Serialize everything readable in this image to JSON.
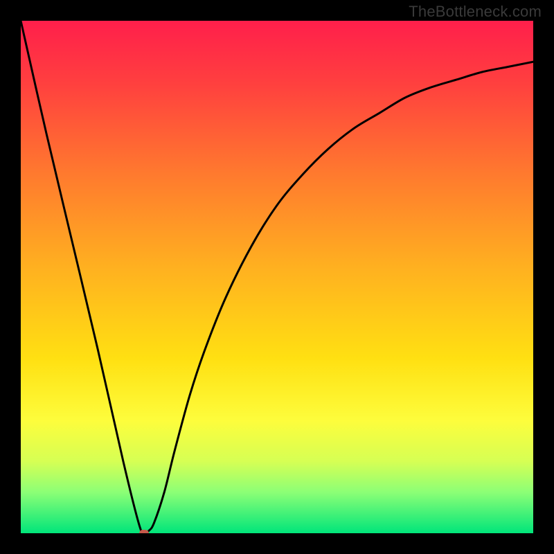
{
  "watermark": {
    "text": "TheBottleneck.com"
  },
  "colors": {
    "gradient_stops": [
      {
        "pct": 0,
        "color": "#ff1f4b"
      },
      {
        "pct": 12,
        "color": "#ff3f3f"
      },
      {
        "pct": 30,
        "color": "#ff7a2e"
      },
      {
        "pct": 48,
        "color": "#ffb020"
      },
      {
        "pct": 66,
        "color": "#ffe012"
      },
      {
        "pct": 78,
        "color": "#fdfd3c"
      },
      {
        "pct": 86,
        "color": "#d6ff54"
      },
      {
        "pct": 92,
        "color": "#8cff76"
      },
      {
        "pct": 100,
        "color": "#00e57a"
      }
    ],
    "curve_stroke": "#000000",
    "marker_fill": "#c55a4b",
    "frame": "#000000"
  },
  "chart_data": {
    "type": "line",
    "title": "",
    "xlabel": "",
    "ylabel": "",
    "xlim": [
      0,
      100
    ],
    "ylim": [
      0,
      100
    ],
    "grid": false,
    "legend": false,
    "series": [
      {
        "name": "bottleneck-curve",
        "x": [
          0,
          5,
          10,
          15,
          20,
          23,
          24,
          25,
          26,
          28,
          30,
          33,
          36,
          40,
          45,
          50,
          55,
          60,
          65,
          70,
          75,
          80,
          85,
          90,
          95,
          100
        ],
        "y": [
          100,
          78,
          57,
          36,
          14,
          2,
          0,
          0.5,
          2,
          8,
          16,
          27,
          36,
          46,
          56,
          64,
          70,
          75,
          79,
          82,
          85,
          87,
          88.5,
          90,
          91,
          92
        ]
      }
    ],
    "marker": {
      "x": 24,
      "y": 0,
      "name": "optimal-point"
    }
  }
}
